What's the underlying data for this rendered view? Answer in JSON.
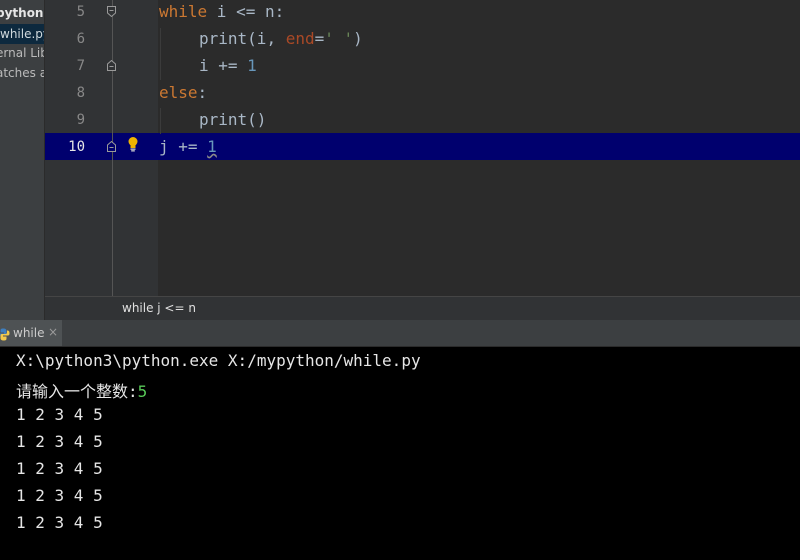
{
  "project": {
    "items": [
      "python",
      "while.py",
      "ernal Lib",
      "atches a"
    ]
  },
  "editor": {
    "line_numbers": [
      "5",
      "6",
      "7",
      "8",
      "9",
      "10"
    ],
    "lines": {
      "l5": {
        "kw": "while",
        "rest": " i <= n:"
      },
      "l6": {
        "fn": "print",
        "open": "(i, ",
        "param": "end",
        "eq": "=",
        "str": "' '",
        "close": ")"
      },
      "l7": {
        "pre": "i += ",
        "num": "1"
      },
      "l8": {
        "kw": "else",
        "rest": ":"
      },
      "l9": {
        "fn": "print",
        "rest": "()"
      },
      "l10": {
        "pre": "j += ",
        "num": "1"
      }
    },
    "current_line": "10"
  },
  "breadcrumb": "while j <= n",
  "run": {
    "tab_label": "while",
    "close": "×",
    "icon": "python-icon"
  },
  "console": {
    "command": "X:\\python3\\python.exe X:/mypython/while.py",
    "prompt": "请输入一个整数:",
    "input_value": "5",
    "output_lines": [
      "1 2 3 4 5",
      "1 2 3 4 5",
      "1 2 3 4 5",
      "1 2 3 4 5",
      "1 2 3 4 5"
    ]
  },
  "colors": {
    "keyword": "#cc7832",
    "number": "#6897bb",
    "string": "#6a8759",
    "current_line": "#00006e",
    "console_input": "#57c957"
  }
}
